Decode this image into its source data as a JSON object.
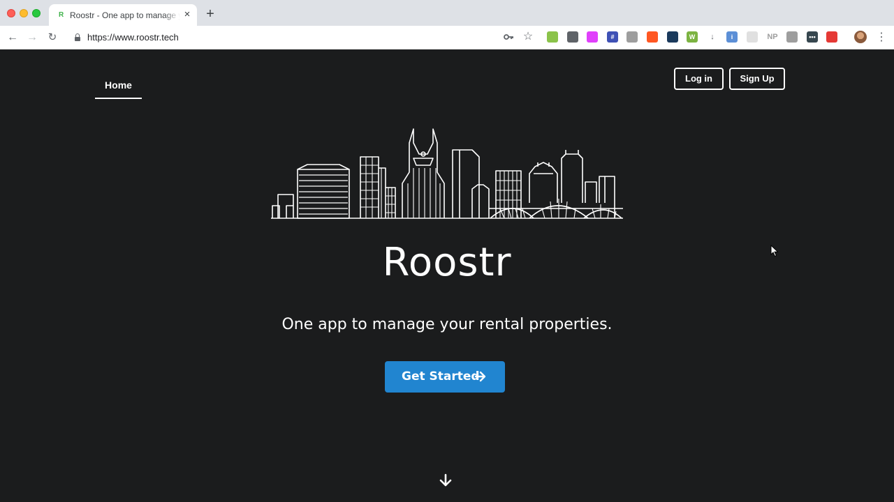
{
  "browser": {
    "tab_title": "Roostr - One app to manage your rental properties",
    "tab_favicon": "R",
    "tab_close": "×",
    "new_tab": "+",
    "url": "https://www.roostr.tech",
    "nav_back": "←",
    "nav_forward": "→",
    "nav_reload": "↻",
    "menu": "⋮",
    "extensions": [
      {
        "name": "sheets-icon",
        "color": "#8bc34a",
        "label": ""
      },
      {
        "name": "screenshot-frame-icon",
        "color": "#5f6368",
        "label": ""
      },
      {
        "name": "gradient-icon",
        "color": "#e040fb",
        "label": ""
      },
      {
        "name": "grid-icon",
        "color": "#3f51b5",
        "label": "#"
      },
      {
        "name": "camera-icon",
        "color": "#9e9e9e",
        "label": ""
      },
      {
        "name": "color-wheel-icon",
        "color": "#ff5722",
        "label": ""
      },
      {
        "name": "react-icon",
        "color": "#1b3a5c",
        "label": ""
      },
      {
        "name": "w-extension-icon",
        "color": "#7cb342",
        "label": "W"
      },
      {
        "name": "download-icon",
        "color": "#5f6368",
        "label": "↓"
      },
      {
        "name": "info-circle-icon",
        "color": "#5c8fd6",
        "label": "i"
      },
      {
        "name": "face-icon",
        "color": "#e0e0e0",
        "label": ""
      },
      {
        "name": "np-icon",
        "color": "#9e9e9e",
        "label": "NP"
      },
      {
        "name": "bug-icon",
        "color": "#9e9e9e",
        "label": ""
      },
      {
        "name": "dark-ext-icon",
        "color": "#37474f",
        "label": "•••"
      },
      {
        "name": "pen-icon",
        "color": "#e53935",
        "label": ""
      }
    ]
  },
  "nav": {
    "home_label": "Home",
    "login_label": "Log in",
    "signup_label": "Sign Up"
  },
  "hero": {
    "title": "Roostr",
    "tagline": "One app to manage your rental properties.",
    "cta_label": "Get Started"
  },
  "colors": {
    "background": "#1b1c1d",
    "cta": "#2185d0",
    "text": "#ffffff"
  }
}
